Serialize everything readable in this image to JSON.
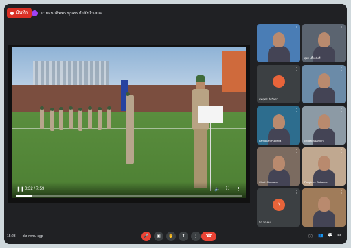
{
  "header": {
    "recording_label": "บันทึก",
    "presenter_label": "นายธนาทิพพร ชุนทร กำลังนำเสนอ"
  },
  "player": {
    "time": "0:32 / 7:59",
    "progress_fraction": 0.07
  },
  "participants": [
    {
      "name": "",
      "kind": "video",
      "bg": "#4a7db5"
    },
    {
      "name": "สุดา เลี้ยงสั่งศี",
      "kind": "video",
      "bg": "#5b6470"
    },
    {
      "name": "สมฤทธิ ลิสวันรา",
      "kind": "avatar",
      "bg": "#3c4043",
      "initial": "",
      "avatar_color": "#e8643a"
    },
    {
      "name": "",
      "kind": "video",
      "bg": "#6b8ba8"
    },
    {
      "name": "Lamduan Pulpriya",
      "kind": "video",
      "bg": "#2d6d8e"
    },
    {
      "name": "chuliat Ssarpen",
      "kind": "video",
      "bg": "#8c9aa5"
    },
    {
      "name": "Chuti Chunlane",
      "kind": "video",
      "bg": "#7b6b60"
    },
    {
      "name": "Puppinee Sakanee",
      "kind": "video",
      "bg": "#c0a890"
    },
    {
      "name": "อีก 30 คน",
      "kind": "more",
      "bg": "#3c4043",
      "initial": "N",
      "avatar_color": "#e8643a"
    },
    {
      "name": "",
      "kind": "video",
      "bg": "#a07c5a"
    }
  ],
  "footer": {
    "time": "15:23",
    "meeting_code": "okr-nwsu-sgp"
  }
}
